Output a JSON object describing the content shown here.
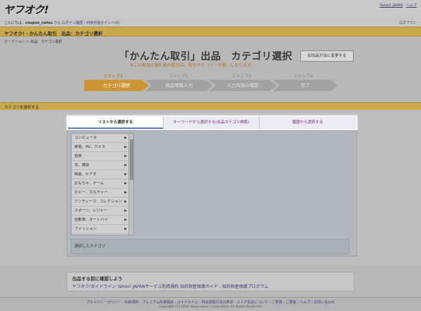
{
  "header": {
    "logo": "ヤフオク!",
    "top_links": [
      "Yahoo! JAPAN",
      "ヘルプ"
    ]
  },
  "user": {
    "greeting_prefix": "こんにちは、",
    "username": "coupon_natsu",
    "greeting_suffix": " さん",
    "links": "ログイン履歴・利用可能ポイント(0)",
    "logout": "ログアウト"
  },
  "titlebar": {
    "title": "ヤフオク! - かんたん取引　出品：カテゴリ選択"
  },
  "breadcrumb": {
    "home": "オークション",
    "sep": " > ",
    "current": "出品：カテゴリ選択"
  },
  "heading": {
    "title": "「かんたん取引」出品　カテゴリ選択",
    "note": "※この商品の落札後の取引は、取引ナビ（ベータ版）になります。",
    "old_form_button": "旧出品方法に変更する"
  },
  "steps": [
    {
      "label": "ステップ1",
      "name": "カテゴリ選択",
      "active": true
    },
    {
      "label": "ステップ2",
      "name": "商品情報入力",
      "active": false
    },
    {
      "label": "ステップ3",
      "name": "入力内容の確認",
      "active": false
    },
    {
      "label": "ステップ4",
      "name": "完了",
      "active": false
    }
  ],
  "section": {
    "title": "カテゴリを選択する"
  },
  "tabs": [
    {
      "label": "リストから選択する",
      "active": true
    },
    {
      "label": "キーワードから選択する(出品カテゴリ検索)",
      "active": false
    },
    {
      "label": "履歴から選択する",
      "active": false
    }
  ],
  "categories": [
    "コンピュータ",
    "家電、AV、カメラ",
    "音楽",
    "本、雑誌",
    "映画、ビデオ",
    "おもちゃ、ゲーム",
    "ホビー、カルチャー",
    "アンティーク、コレクション",
    "スポーツ、レジャー",
    "自動車、オートバイ",
    "ファッション"
  ],
  "selected": {
    "label": "選択したカテゴリ"
  },
  "before_listing": {
    "title": "出品する前に確認しよう",
    "links": "ヤフオク!ガイドライン Yahoo! JAPANサービス利用規約 知的財産保護ガイド - 知的財産保護プログラム"
  },
  "footer": {
    "links": "プライバシーポリシー - 利用規約 - プレミアム利用規約 - ガイドライン - 特定商取引法の表示 - ストア出店について - ご意見・ご要望 - ヘルプ・お問い合わせ",
    "copyright": "Copyright (C) 2015 Yahoo Japan Corporation. All Rights Reserved."
  }
}
